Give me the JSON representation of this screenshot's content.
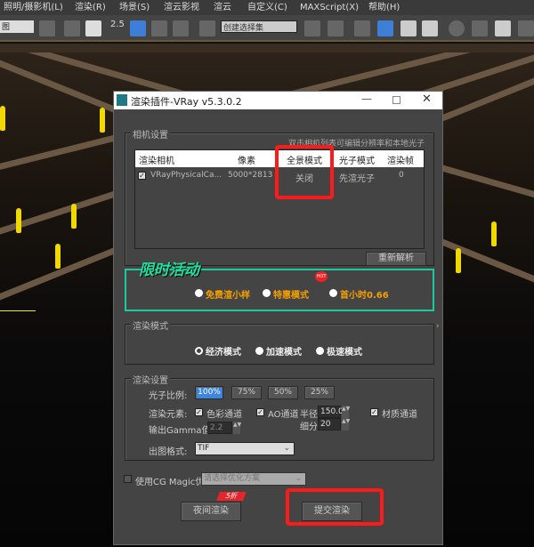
{
  "menu": [
    "照明/摄影机(L)",
    "渲染(R)",
    "场景(S)",
    "渲云影视",
    "渲云",
    "自定义(C)",
    "MAXScript(X)",
    "帮助(H)"
  ],
  "toolbar": {
    "view_select": "图",
    "snap_value": "2.5",
    "selection_set_placeholder": "创建选择集"
  },
  "dialog": {
    "title": "渲染插件-VRay v5.3.0.2",
    "camera_group": {
      "label": "相机设置",
      "hint": "双击相机列表可编辑分辨率和本地光子",
      "columns": [
        "渲染相机",
        "像素",
        "全景模式",
        "光子模式",
        "渲染帧"
      ],
      "rows": [
        {
          "checked": true,
          "camera": "VRayPhysicalCa...",
          "pixels": "5000*2813",
          "panorama": "关闭",
          "photon": "先渲光子",
          "frame": "0"
        }
      ],
      "reparse": "重新解析"
    },
    "promo": {
      "title": "限时活动",
      "hot": "HOT",
      "options": [
        "免费渲小样",
        "特惠模式",
        "首小时0.66"
      ],
      "accent": "#1fc9a0",
      "text_color": "#f5a000"
    },
    "render_mode": {
      "label": "渲染模式",
      "options": [
        "经济模式",
        "加速模式",
        "极速模式"
      ],
      "selected": 0
    },
    "render_settings": {
      "label": "渲染设置",
      "photon_ratio_label": "光子比例:",
      "ratios": [
        "100%",
        "75%",
        "50%",
        "25%"
      ],
      "selected_ratio": 0,
      "elements_label": "渲染元素:",
      "color_channel": "色彩通道",
      "ao_channel": "AO通道",
      "radius_label": "半径",
      "radius": "150.0",
      "material_channel": "材质通道",
      "subdiv_label": "细分",
      "subdiv": "20",
      "gamma_label": "输出Gamma值:",
      "gamma": "2.2",
      "format_label": "出图格式:",
      "format": "TIF"
    },
    "cgmagic": {
      "label": "使用CG Magic优化",
      "placeholder": "请选择优化方案",
      "checked": false
    },
    "night_render": "夜间渲染",
    "discount": "5折",
    "submit": "提交渲染"
  }
}
